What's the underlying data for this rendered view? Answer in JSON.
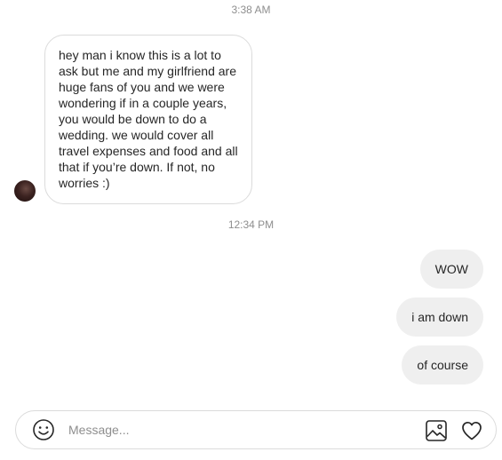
{
  "thread": {
    "timestamp_1": "3:38 AM",
    "incoming_message": "hey man i know this is a lot to\nask but me and my girlfriend are\nhuge fans of you and we were\nwondering if in a couple years,\nyou would be down to do a\nwedding. we would cover all\ntravel expenses and food and all\nthat if you’re down. If not, no\nworries :)",
    "timestamp_2": "12:34 PM",
    "outgoing_messages": [
      "WOW",
      "i am down",
      "of course"
    ]
  },
  "composer": {
    "placeholder": "Message...",
    "value": "",
    "icons": [
      "emoji-icon",
      "image-icon",
      "heart-icon"
    ]
  }
}
